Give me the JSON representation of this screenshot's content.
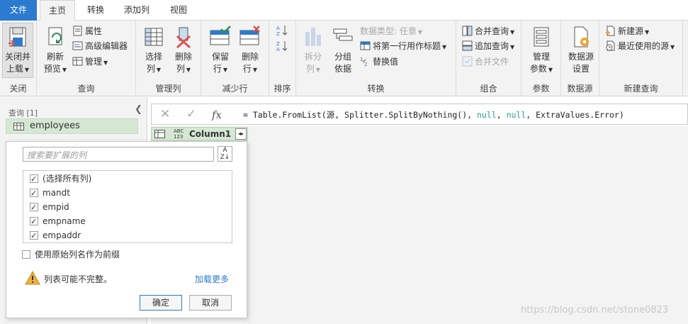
{
  "tabs": [
    {
      "label": "文件"
    },
    {
      "label": "主页"
    },
    {
      "label": "转换"
    },
    {
      "label": "添加列"
    },
    {
      "label": "视图"
    }
  ],
  "ribbon": {
    "close_group": {
      "label": "关闭",
      "close_load_line1": "关闭并",
      "close_load_line2": "上载"
    },
    "query_group": {
      "label": "查询",
      "refresh_line1": "刷新",
      "refresh_line2": "预览",
      "properties": "属性",
      "advanced_editor": "高级编辑器",
      "manage": "管理"
    },
    "manage_cols_group": {
      "label": "管理列",
      "choose_line1": "选择",
      "choose_line2": "列",
      "remove_line1": "删除",
      "remove_line2": "列"
    },
    "reduce_rows_group": {
      "label": "减少行",
      "keep_line1": "保留",
      "keep_line2": "行",
      "remove_line1": "删除",
      "remove_line2": "行"
    },
    "sort_group": {
      "label": "排序"
    },
    "transform_group": {
      "label": "转换",
      "split_line1": "拆分",
      "split_line2": "列",
      "group_line1": "分组",
      "group_line2": "依据",
      "data_type": "数据类型: 任意",
      "first_row_header": "将第一行用作标题",
      "replace_values": "替换值"
    },
    "combine_group": {
      "label": "组合",
      "merge_queries": "合并查询",
      "append_queries": "追加查询",
      "combine_files": "合并文件"
    },
    "params_group": {
      "label": "参数",
      "manage_line1": "管理",
      "manage_line2": "参数"
    },
    "datasource_group": {
      "label": "数据源",
      "settings_line1": "数据源",
      "settings_line2": "设置"
    },
    "new_query_group": {
      "label": "新建查询",
      "new_source": "新建源",
      "recent_sources": "最近使用的源"
    }
  },
  "queries_panel": {
    "header": "查询 [1]",
    "items": [
      {
        "label": "employees"
      }
    ]
  },
  "formula_bar": {
    "prefix": "= Table.FromList(源, Splitter.SplitByNothing(), ",
    "null1": "null",
    "sep1": ", ",
    "null2": "null",
    "suffix": ", ExtraValues.Error)"
  },
  "column_header": {
    "type_badge_top": "ABC",
    "type_badge_bottom": "123",
    "name": "Column1"
  },
  "expand_popup": {
    "search_placeholder": "搜索要扩展的列",
    "items": [
      {
        "label": "(选择所有列)",
        "checked": true
      },
      {
        "label": "mandt",
        "checked": true
      },
      {
        "label": "empid",
        "checked": true
      },
      {
        "label": "empname",
        "checked": true
      },
      {
        "label": "empaddr",
        "checked": true
      }
    ],
    "use_prefix_label": "使用原始列名作为前缀",
    "use_prefix_checked": false,
    "warning_text": "列表可能不完整。",
    "load_more": "加载更多",
    "ok_label": "确定",
    "cancel_label": "取消"
  },
  "watermark": "https://blog.csdn.net/stone0823",
  "colors": {
    "accent": "#2b7bce",
    "query_selected": "#d5e8d4",
    "ribbon_bg": "#f3f3f3"
  }
}
